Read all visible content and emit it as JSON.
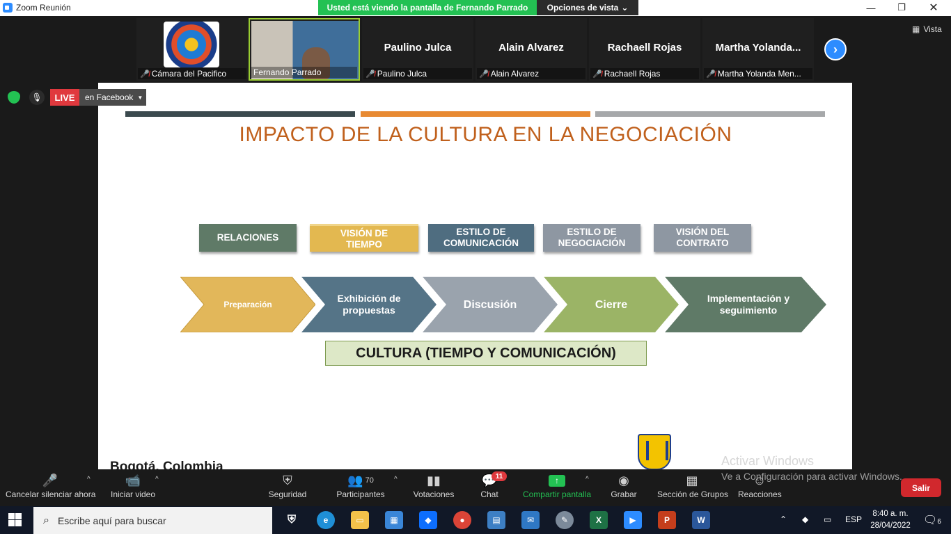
{
  "window": {
    "title": "Zoom Reunión"
  },
  "share_banner": "Usted está viendo la pantalla de Fernando Parrado",
  "view_options": "Opciones de vista",
  "view_toggle": "Vista",
  "participants": [
    {
      "name": "",
      "label": "Cámara del Pacifico",
      "muted": true
    },
    {
      "name": "",
      "label": "Fernando Parrado",
      "muted": false
    },
    {
      "name": "Paulino Julca",
      "label": "Paulino Julca",
      "muted": true
    },
    {
      "name": "Alain Alvarez",
      "label": "Alain Alvarez",
      "muted": true
    },
    {
      "name": "Rachaell Rojas",
      "label": "Rachaell Rojas",
      "muted": true
    },
    {
      "name": "Martha  Yolanda...",
      "label": "Martha Yolanda Men...",
      "muted": true
    }
  ],
  "live": {
    "badge": "LIVE",
    "target": "en Facebook"
  },
  "slide": {
    "title": "IMPACTO DE LA CULTURA EN LA NEGOCIACIÓN",
    "boxes": [
      "RELACIONES",
      "VISIÓN DE TIEMPO",
      "ESTILO DE COMUNICACIÓN",
      "ESTILO DE NEGOCIACIÓN",
      "VISIÓN DEL CONTRATO"
    ],
    "stages": [
      "Preparación",
      "Exhibición de propuestas",
      "Discusión",
      "Cierre",
      "Implementación y seguimiento"
    ],
    "culture": "CULTURA (TIEMPO Y COMUNICACIÓN)",
    "footer": "Bogotá, Colombia"
  },
  "colors": {
    "bar_dark": "#3b4a4e",
    "bar_orange": "#e88a32",
    "bar_gray": "#a6a8aa",
    "title": "#c0601c",
    "relaciones": "#5f7a67",
    "vision_tiempo": "#e3b850",
    "estilo_com": "#4f6d80",
    "estilo_neg": "#8e97a2",
    "vision_contrato": "#8e97a2"
  },
  "toolbar": {
    "unmute": "Cancelar silenciar ahora",
    "start_video": "Iniciar video",
    "security": "Seguridad",
    "participants": "Participantes",
    "participants_count": "70",
    "polls": "Votaciones",
    "chat": "Chat",
    "chat_badge": "11",
    "share_screen": "Compartir pantalla",
    "record": "Grabar",
    "breakout": "Sección de Grupos",
    "reactions": "Reacciones",
    "exit": "Salir"
  },
  "watermark": {
    "line1": "Activar Windows",
    "line2": "Ve a Configuración para activar Windows."
  },
  "taskbar": {
    "search_placeholder": "Escribe aquí para buscar",
    "language": "ESP",
    "time": "8:40 a. m.",
    "date": "28/04/2022",
    "notifications": "6"
  }
}
